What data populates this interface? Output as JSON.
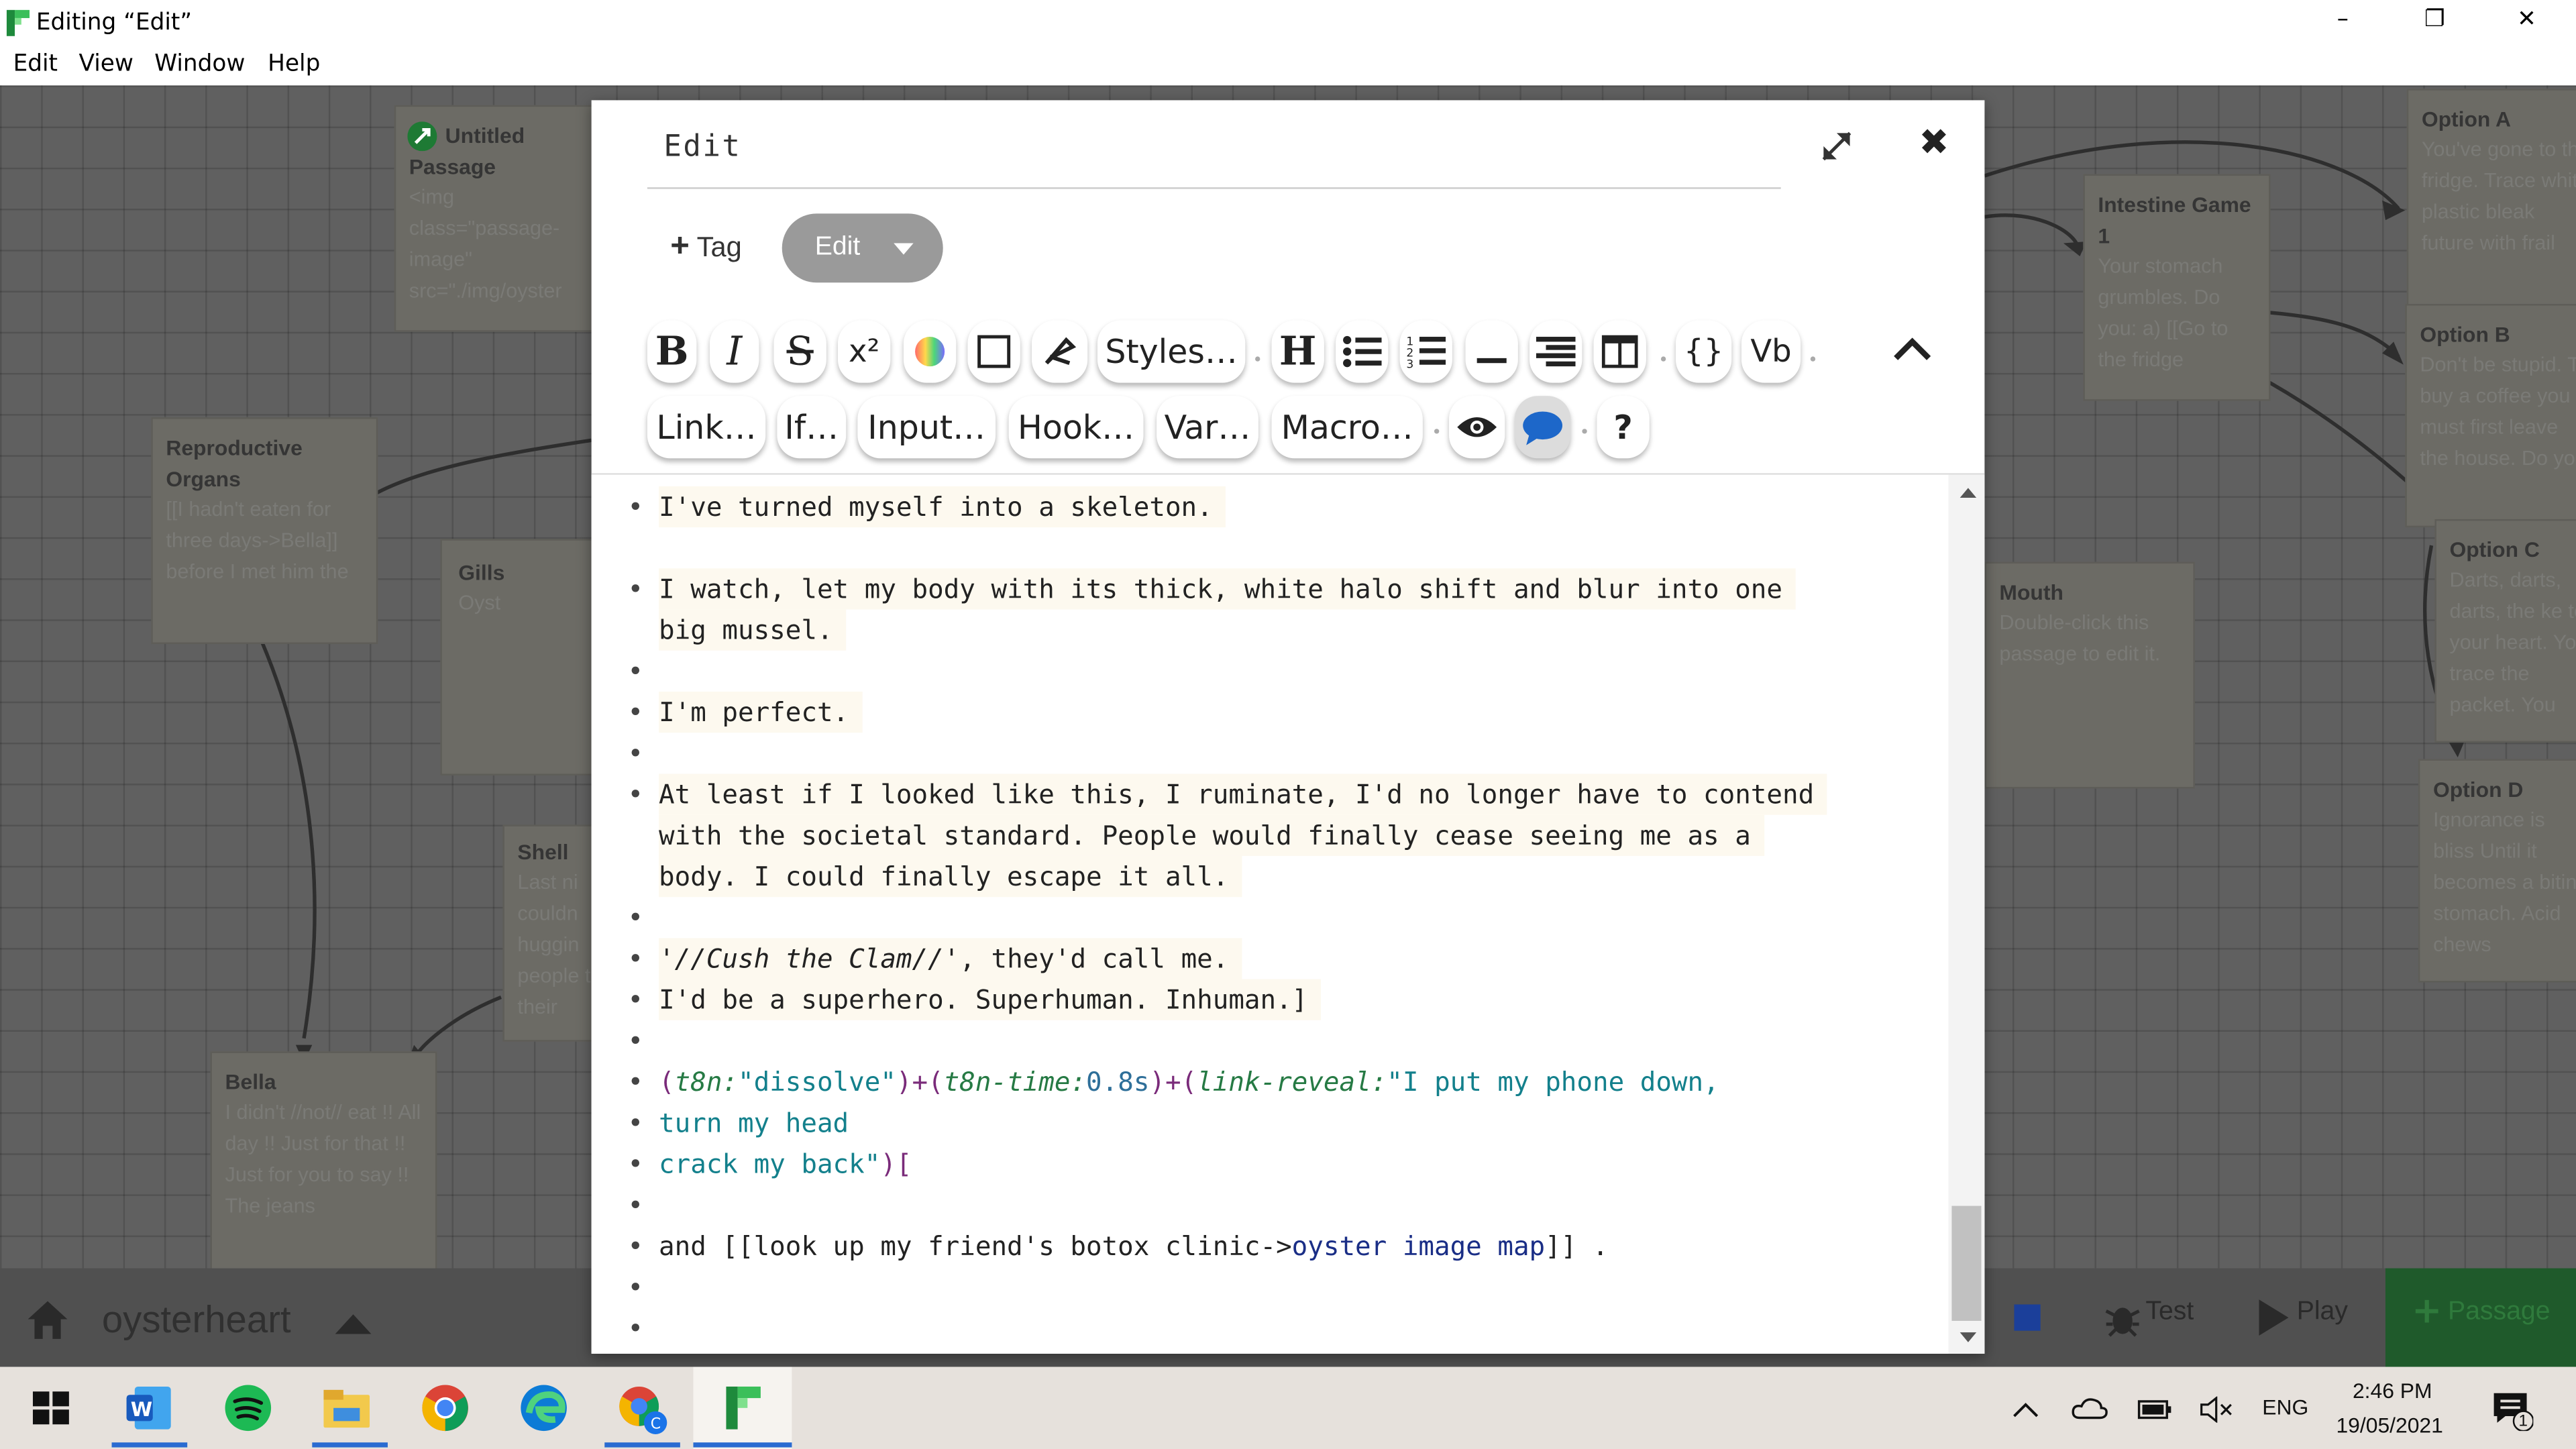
{
  "window": {
    "title": "Editing “Edit”",
    "minimize": "–",
    "restore": "❐",
    "close": "✕"
  },
  "menu": [
    "Edit",
    "View",
    "Window",
    "Help"
  ],
  "passages": [
    {
      "title": "Untitled Passage",
      "excerpt": "<img class=\"passage-image\" src=\"./img/oyster"
    },
    {
      "title": "Reproductive Organs",
      "excerpt": "[[I hadn't eaten for three days->Bella]] before I met him the"
    },
    {
      "title": "Gills",
      "excerpt": "Oyst"
    },
    {
      "title": "Shell",
      "excerpt": "Last ni couldn huggin people to their"
    },
    {
      "title": "Bella",
      "excerpt": "I didn't //not// eat !! All day !! Just for that !! Just for you to say !! The jeans"
    },
    {
      "title": "Intestine Game 1",
      "excerpt": "Your stomach grumbles. Do you: a) [[Go to the fridge"
    },
    {
      "title": "Mouth",
      "excerpt": "Double-click this passage to edit it."
    },
    {
      "title": "Option A",
      "excerpt": "You've gone to the fridge. Trace white plastic bleak future with frail"
    },
    {
      "title": "Option B",
      "excerpt": "Don't be stupid. To buy a coffee you must first leave the house. Do you"
    },
    {
      "title": "Option C",
      "excerpt": "Darts, darts, darts, the ke to your heart. You trace the packet. You"
    },
    {
      "title": "Option D",
      "excerpt": "Ignorance is bliss Until it becomes a biting stomach. Acid chews"
    }
  ],
  "story_bar": {
    "story_name": "oysterheart",
    "test_label": "Test",
    "play_label": "Play",
    "passage_label": "Passage"
  },
  "dialog": {
    "title": "Edit",
    "tag_label": "Tag",
    "passage_type": "Edit",
    "toolbar_row1": [
      "B",
      "I",
      "S",
      "x²",
      "Styles…",
      "H",
      "{}",
      "Vb"
    ],
    "toolbar_row2": [
      "Link…",
      "If…",
      "Input…",
      "Hook…",
      "Var…",
      "Macro…",
      "?"
    ]
  },
  "editor": {
    "lines": {
      "l1": "I've turned myself into a skeleton.",
      "l2": "I watch, let my body with its thick, white halo shift and blur into one",
      "l2b": "big mussel.",
      "l3": "I'm perfect.",
      "l4": "At least if I looked like this, I ruminate, I'd no longer have to contend",
      "l4b": "with the societal standard. People would finally cease seeing me as a",
      "l4c": "body. I could finally escape it all.",
      "l5a": "'",
      "l5b": "//Cush the Clam//",
      "l5c": "', they'd call me.",
      "l6": "I'd be a superhero. Superhuman. Inhuman.]",
      "m1": "(",
      "m2": "t8n:",
      "m3": "\"dissolve\"",
      "m4": ")+(",
      "m5": "t8n-time:",
      "m6": "0.8s",
      "m7": ")+(",
      "m8": "link-reveal:",
      "m9": "\"I put my phone down,",
      "m10": "turn my head",
      "m11": "crack my back\"",
      "m12": ")[",
      "k1": "and [[",
      "k2": "look up my friend's botox clinic->",
      "k3": "oyster image map",
      "k4": "]] ."
    }
  },
  "tray": {
    "language": "ENG",
    "time": "2:46 PM",
    "date": "19/05/2021",
    "notification_count": "1"
  },
  "colors": {
    "accent_green": "#1e7a34",
    "hook_purple": "#7a2b7a",
    "string_teal": "#13808c"
  }
}
